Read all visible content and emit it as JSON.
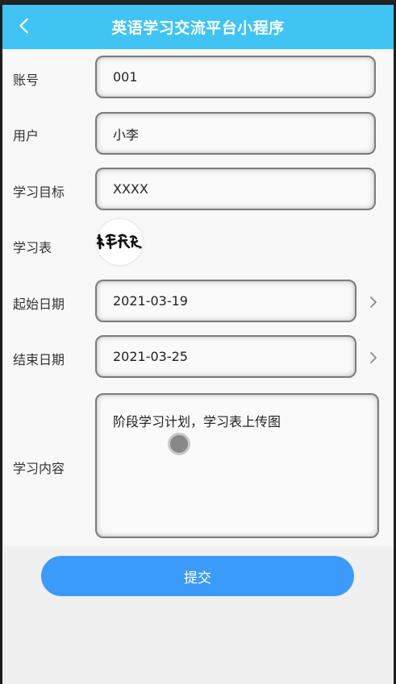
{
  "header": {
    "title": "英语学习交流平台小程序",
    "back_icon": "chevron-left-icon"
  },
  "form": {
    "account": {
      "label": "账号",
      "value": "001"
    },
    "user": {
      "label": "用户",
      "value": "小李"
    },
    "goal": {
      "label": "学习目标",
      "value": "XXXX"
    },
    "table": {
      "label": "学习表",
      "image_text": "长空谷"
    },
    "start_date": {
      "label": "起始日期",
      "value": "2021-03-19"
    },
    "end_date": {
      "label": "结束日期",
      "value": "2021-03-25"
    },
    "content": {
      "label": "学习内容",
      "value": "阶段学习计划，学习表上传图"
    }
  },
  "submit": {
    "label": "提交"
  },
  "colors": {
    "navbar": "#3fc4f4",
    "submit": "#3b9bfa"
  }
}
